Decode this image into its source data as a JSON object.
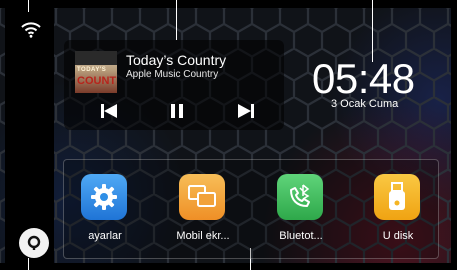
{
  "now_playing": {
    "title": "Today’s Country",
    "subtitle": "Apple Music Country",
    "album_art_text_top": "TODAY'S",
    "album_art_text_bottom": "COUNTRY"
  },
  "clock": {
    "time": "05:48",
    "date": "3 Ocak Cuma"
  },
  "dock": {
    "apps": [
      {
        "label": "ayarlar",
        "icon": "settings-gear-icon",
        "color": "#2f8fe6"
      },
      {
        "label": "Mobil ekr...",
        "icon": "screen-mirror-icon",
        "color": "#f2a23a"
      },
      {
        "label": "Bluetot...",
        "icon": "bluetooth-phone-icon",
        "color": "#3fbf5a"
      },
      {
        "label": "U disk",
        "icon": "usb-drive-icon",
        "color": "#f5b523"
      }
    ]
  },
  "colors": {
    "background": "#101318",
    "sidebar": "#000000",
    "accent_red": "#b8241c"
  }
}
